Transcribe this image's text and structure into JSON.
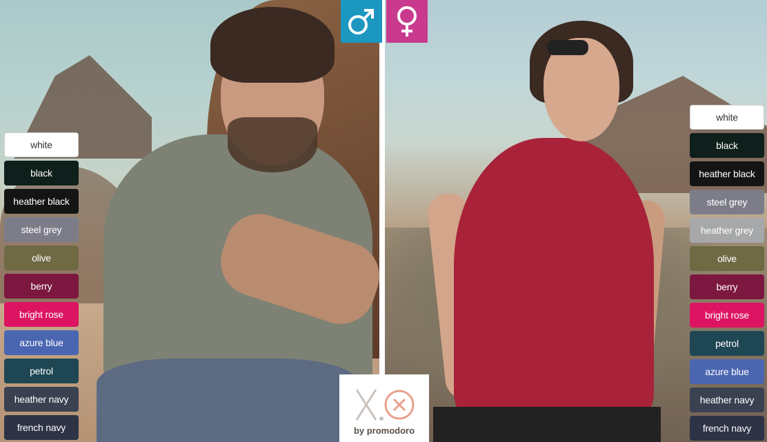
{
  "icons": {
    "male": "male-symbol-icon",
    "female": "female-symbol-icon"
  },
  "colors": {
    "male_icon_bg": "#1c97c0",
    "female_icon_bg": "#c93a8e",
    "men_shirt": "#7d8274",
    "women_shirt": "#a8233a"
  },
  "men_swatches": [
    {
      "label": "white",
      "color": "#ffffff"
    },
    {
      "label": "black",
      "color": "#0f1f1b"
    },
    {
      "label": "heather black",
      "color": "#141414"
    },
    {
      "label": "steel grey",
      "color": "#7c7d89"
    },
    {
      "label": "olive",
      "color": "#6f6a44"
    },
    {
      "label": "berry",
      "color": "#7c1840"
    },
    {
      "label": "bright rose",
      "color": "#dc1462"
    },
    {
      "label": "azure blue",
      "color": "#4a66b1"
    },
    {
      "label": "petrol",
      "color": "#1e4653"
    },
    {
      "label": "heather navy",
      "color": "#3a4252"
    },
    {
      "label": "french navy",
      "color": "#2e3346"
    }
  ],
  "women_swatches": [
    {
      "label": "white",
      "color": "#ffffff"
    },
    {
      "label": "black",
      "color": "#0f1f1b"
    },
    {
      "label": "heather black",
      "color": "#141414"
    },
    {
      "label": "steel grey",
      "color": "#7c7d89"
    },
    {
      "label": "heather grey",
      "color": "#a6a8aa"
    },
    {
      "label": "olive",
      "color": "#6f6a44"
    },
    {
      "label": "berry",
      "color": "#7c1840"
    },
    {
      "label": "bright rose",
      "color": "#dc1462"
    },
    {
      "label": "petrol",
      "color": "#1e4653"
    },
    {
      "label": "azure blue",
      "color": "#4a66b1"
    },
    {
      "label": "heather navy",
      "color": "#3a4252"
    },
    {
      "label": "french navy",
      "color": "#2e3346"
    }
  ],
  "logo": {
    "mark": "X.⊗",
    "tagline": "by promodoro"
  }
}
